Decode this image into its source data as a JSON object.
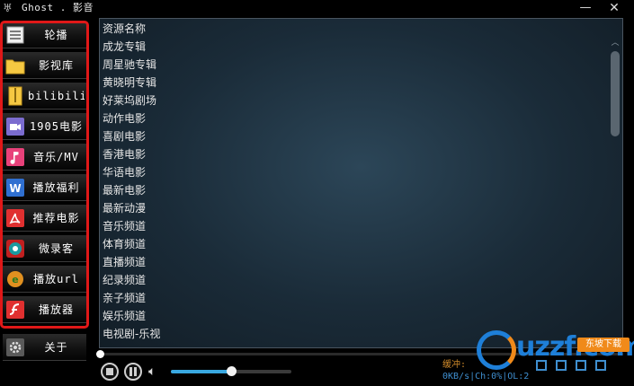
{
  "window": {
    "title": "Ghost . 影音",
    "minimize_glyph": "—",
    "close_glyph": "✕"
  },
  "sidebar": {
    "items": [
      {
        "label": "轮播",
        "icon": "list-icon",
        "color": "#f0f0f0"
      },
      {
        "label": "影视库",
        "icon": "folder-icon",
        "color": "#f5c842"
      },
      {
        "label": "bilibili",
        "icon": "zip-folder-icon",
        "color": "#f5c842"
      },
      {
        "label": "1905电影",
        "icon": "video-icon",
        "color": "#7b6ccf"
      },
      {
        "label": "音乐/MV",
        "icon": "music-icon",
        "color": "#e8417a"
      },
      {
        "label": "播放福利",
        "icon": "word-doc-icon",
        "color": "#2f6fd0"
      },
      {
        "label": "推荐电影",
        "icon": "pdf-icon",
        "color": "#e03030"
      },
      {
        "label": "微录客",
        "icon": "record-icon",
        "color": "#1a9aa0"
      },
      {
        "label": "播放url",
        "icon": "ie-browser-icon",
        "color": "#e09020"
      },
      {
        "label": "播放器",
        "icon": "flash-icon",
        "color": "#e03030"
      },
      {
        "label": "关于",
        "icon": "gear-icon",
        "color": "#9a9a9a"
      }
    ]
  },
  "list": {
    "rows": [
      "资源名称",
      "成龙专辑",
      "周星驰专辑",
      "黄晓明专辑",
      "好莱坞剧场",
      "动作电影",
      "喜剧电影",
      "香港电影",
      "华语电影",
      "最新电影",
      "最新动漫",
      "音乐频道",
      "体育频道",
      "直播频道",
      "纪录频道",
      "亲子频道",
      "娱乐频道",
      "电视剧-乐视"
    ]
  },
  "player": {
    "progress": 0,
    "volume": 0.5,
    "buffer_label": "缓冲:",
    "stats_label": "0KB/s|Ch:0%|OL:2"
  },
  "watermark": {
    "logo_text": "uzzf.com",
    "tag_text": "东坡下载"
  },
  "colors": {
    "accent": "#e01818",
    "panel": "#1a2b38",
    "link_blue": "#3f8fd0"
  }
}
